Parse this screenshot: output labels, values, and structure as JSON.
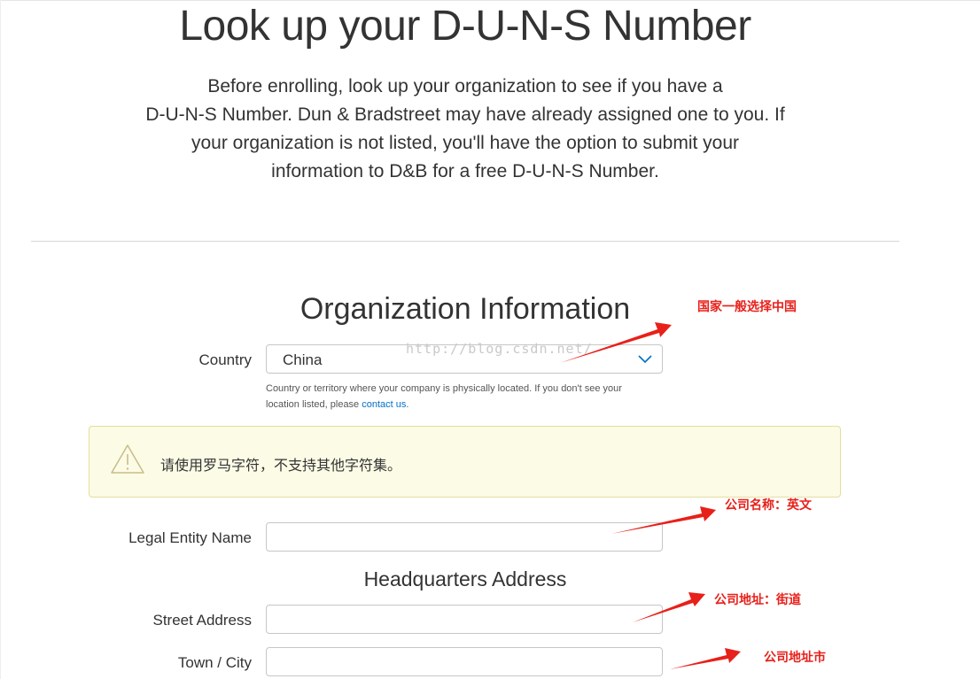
{
  "header": {
    "title": "Look up your D-U-N-S Number",
    "intro_lines": [
      "Before enrolling, look up your organization to see if you have a",
      "D-U-N-S Number. Dun & Bradstreet may have already assigned one to you. If",
      "your organization is not listed, you'll have the option to submit your",
      "information to D&B for a free D-U-N-S Number."
    ]
  },
  "org_info": {
    "title": "Organization Information",
    "country": {
      "label": "Country",
      "value": "China",
      "helper_text": "Country or territory where your company is physically located. If you don't see your",
      "helper_text_2": "location listed, please ",
      "helper_link": "contact us",
      "helper_end": "."
    },
    "alert": {
      "text": "请使用罗马字符，不支持其他字符集。"
    },
    "legal_entity": {
      "label": "Legal Entity Name",
      "value": ""
    }
  },
  "headquarters": {
    "title": "Headquarters Address",
    "street": {
      "label": "Street Address",
      "value": ""
    },
    "city": {
      "label": "Town / City",
      "value": ""
    }
  },
  "watermark": "http://blog.csdn.net/",
  "annotations": [
    {
      "text": "国家一般选择中国"
    },
    {
      "text": "公司名称：英文"
    },
    {
      "text": "公司地址：街道"
    },
    {
      "text": "公司地址市"
    }
  ],
  "colors": {
    "accent_link": "#0070c9",
    "annotation_red": "#e8201a",
    "alert_bg": "#fcfbe6"
  }
}
